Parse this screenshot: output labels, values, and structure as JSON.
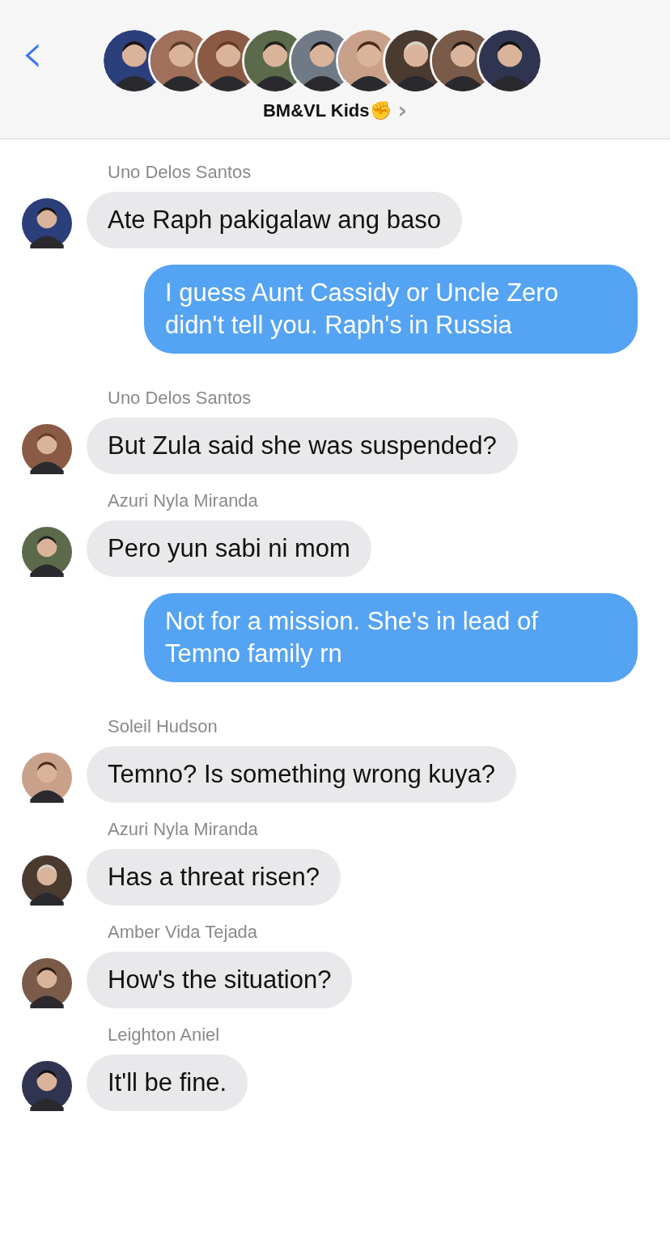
{
  "header": {
    "back": "‹",
    "title": "BM&VL Kids✊",
    "chevron": "›"
  },
  "messages": [
    {
      "kind": "incoming",
      "sender": "Uno Delos Santos",
      "text": "Ate Raph pakigalaw ang baso"
    },
    {
      "kind": "outgoing",
      "text": "I guess Aunt Cassidy or Uncle Zero didn't tell you. Raph's in Russia"
    },
    {
      "kind": "incoming",
      "sender": "Uno Delos Santos",
      "text": "But Zula said she was suspended?"
    },
    {
      "kind": "incoming",
      "sender": "Azuri Nyla Miranda",
      "text": "Pero yun sabi ni mom"
    },
    {
      "kind": "outgoing",
      "text": "Not for a mission. She's in lead of Temno family rn"
    },
    {
      "kind": "incoming",
      "sender": "Soleil Hudson",
      "text": "Temno? Is something wrong kuya?"
    },
    {
      "kind": "incoming",
      "sender": "Azuri Nyla Miranda",
      "text": "Has a threat risen?"
    },
    {
      "kind": "incoming",
      "sender": "Amber Vida Tejada",
      "text": "How's the situation?"
    },
    {
      "kind": "incoming",
      "sender": "Leighton Aniel",
      "text": "It'll be fine."
    }
  ]
}
